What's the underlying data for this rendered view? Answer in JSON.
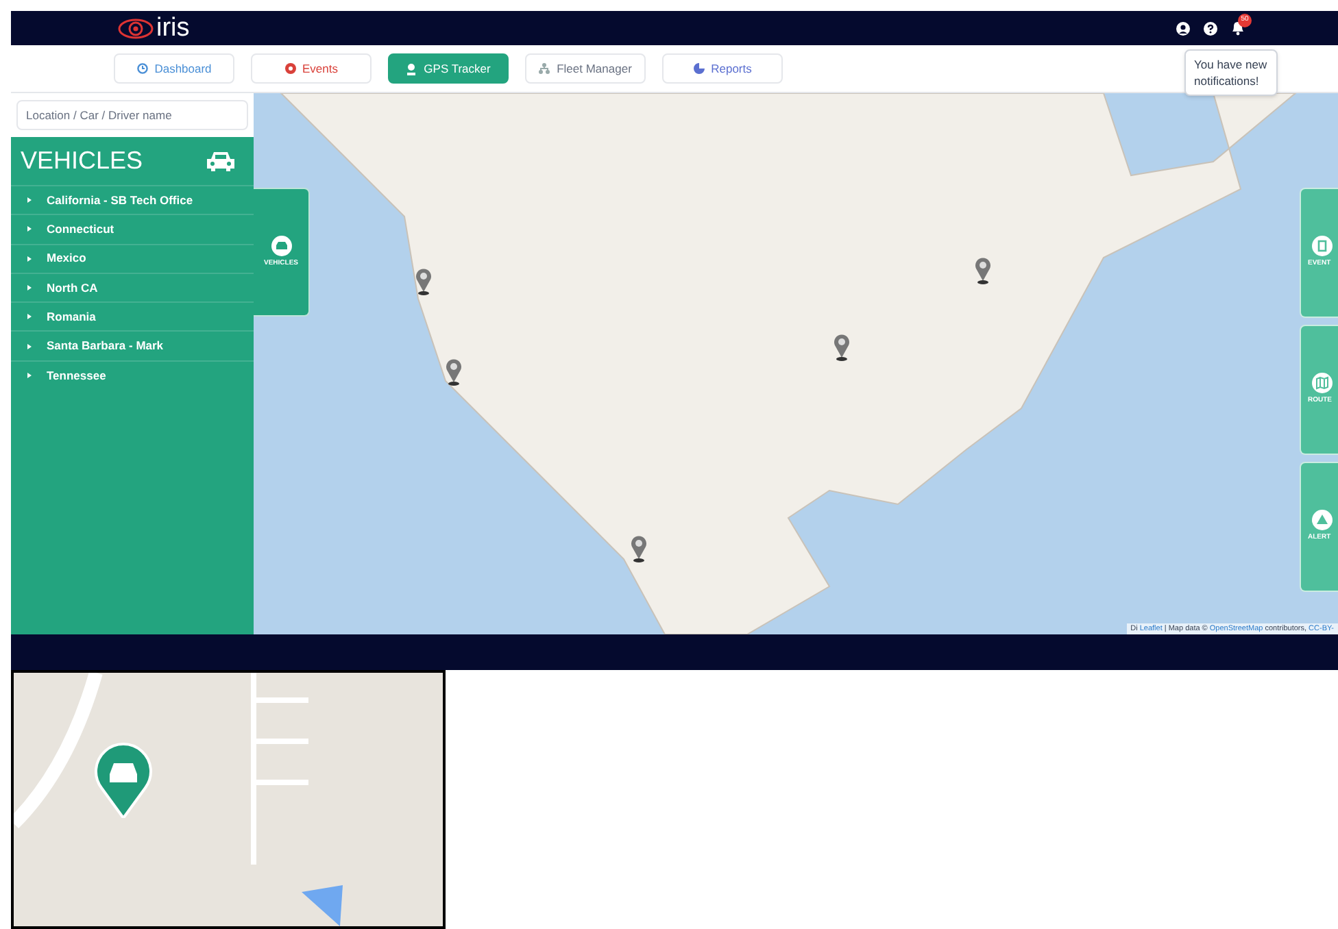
{
  "brand": "iris",
  "header_icons": [
    {
      "kind": "user"
    },
    {
      "kind": "help"
    },
    {
      "kind": "bell",
      "badge": "50"
    }
  ],
  "notification_tooltip": "You have new notifications!",
  "nav_tabs": [
    {
      "label": "Dashboard",
      "kind": "clock",
      "selected": false
    },
    {
      "label": "Events",
      "kind": "dot",
      "selected": false
    },
    {
      "label": "GPS Tracker",
      "kind": "person",
      "selected": true
    },
    {
      "label": "Fleet Manager",
      "kind": "tree",
      "selected": false
    },
    {
      "label": "Reports",
      "kind": "pie",
      "selected": false
    }
  ],
  "search": {
    "placeholder": "Location / Car / Driver name"
  },
  "vehicles_panel": {
    "title": "VEHICLES",
    "groups": [
      "California - SB Tech Office",
      "Connecticut",
      "Mexico",
      "North CA",
      "Romania",
      "Santa Barbara - Mark",
      "Tennessee"
    ]
  },
  "vehicles_tab": {
    "label": "VEHICLES"
  },
  "side_tabs": [
    {
      "label": "EVENT",
      "kind": "events"
    },
    {
      "label": "ROUTE",
      "kind": "routes"
    },
    {
      "label": "ALERT",
      "kind": "alerts"
    }
  ],
  "attribution": {
    "prefix": "Di",
    "leaflet": "Leaflet",
    "text": "| Map data ©",
    "osm": "OpenStreetMap",
    "rest": "contributors,",
    "license": "CC-BY-"
  }
}
